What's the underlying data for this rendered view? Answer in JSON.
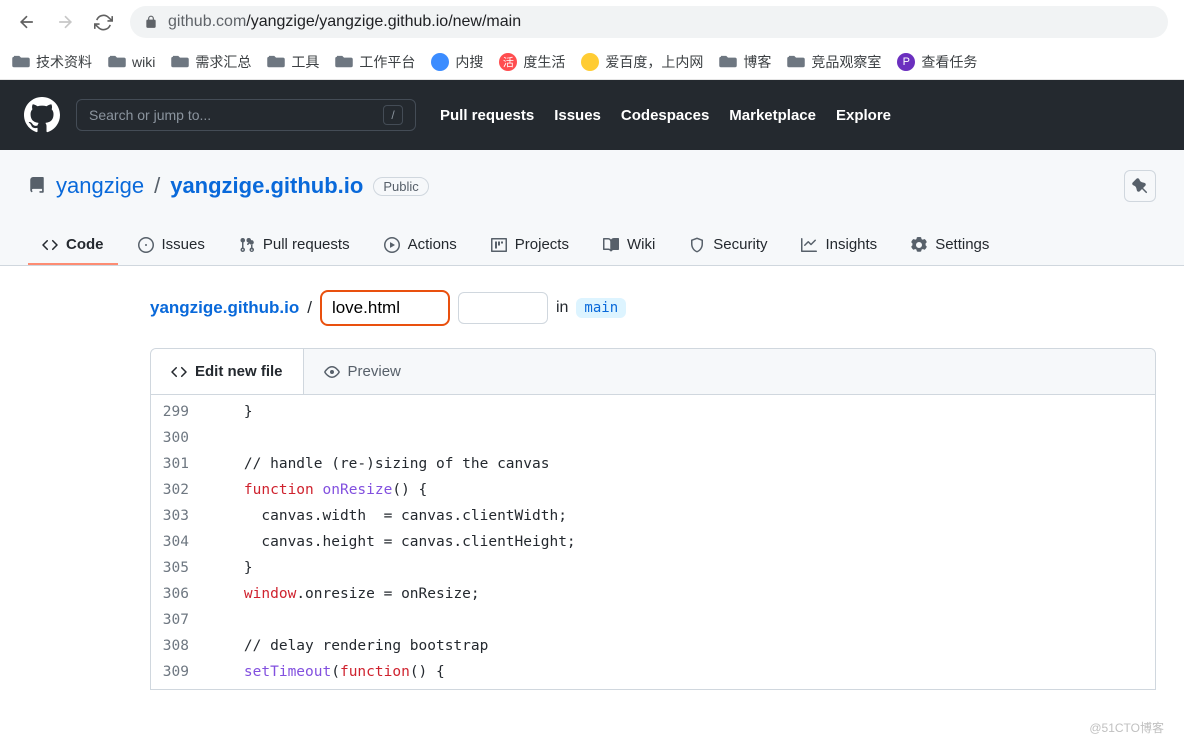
{
  "browser": {
    "url_host": "github.com",
    "url_path": "/yangzige/yangzige.github.io/new/main"
  },
  "bookmarks": [
    {
      "type": "folder",
      "label": "技术资料"
    },
    {
      "type": "folder",
      "label": "wiki"
    },
    {
      "type": "folder",
      "label": "需求汇总"
    },
    {
      "type": "folder",
      "label": "工具"
    },
    {
      "type": "folder",
      "label": "工作平台"
    },
    {
      "type": "icon",
      "label": "内搜",
      "bg": "#3b8cff"
    },
    {
      "type": "icon",
      "label": "度生活",
      "bg": "#ff4d4f",
      "glyph": "活"
    },
    {
      "type": "icon",
      "label": "爱百度，上内网",
      "bg": "#ffcc33"
    },
    {
      "type": "folder",
      "label": "博客"
    },
    {
      "type": "folder",
      "label": "竞品观察室"
    },
    {
      "type": "icon",
      "label": "查看任务",
      "bg": "#6b2fbf",
      "glyph": "P"
    }
  ],
  "github": {
    "search_placeholder": "Search or jump to...",
    "slash": "/",
    "nav": [
      "Pull requests",
      "Issues",
      "Codespaces",
      "Marketplace",
      "Explore"
    ]
  },
  "repo": {
    "owner": "yangzige",
    "name": "yangzige.github.io",
    "visibility": "Public",
    "tabs": [
      {
        "icon": "code",
        "label": "Code",
        "active": true
      },
      {
        "icon": "issue",
        "label": "Issues"
      },
      {
        "icon": "pr",
        "label": "Pull requests"
      },
      {
        "icon": "actions",
        "label": "Actions"
      },
      {
        "icon": "projects",
        "label": "Projects"
      },
      {
        "icon": "wiki",
        "label": "Wiki"
      },
      {
        "icon": "security",
        "label": "Security"
      },
      {
        "icon": "insights",
        "label": "Insights"
      },
      {
        "icon": "settings",
        "label": "Settings"
      }
    ]
  },
  "file": {
    "repo_path": "yangzige.github.io",
    "filename": "love.html",
    "in_label": "in",
    "branch": "main"
  },
  "editor": {
    "tab_edit": "Edit new file",
    "tab_preview": "Preview",
    "lines": [
      {
        "no": 299,
        "tokens": [
          [
            "    }",
            ""
          ]
        ]
      },
      {
        "no": 300,
        "tokens": [
          [
            "",
            ""
          ]
        ]
      },
      {
        "no": 301,
        "tokens": [
          [
            "    // handle (re-)sizing of the canvas",
            "comment"
          ]
        ]
      },
      {
        "no": 302,
        "tokens": [
          [
            "    ",
            ""
          ],
          [
            "function",
            "keyword"
          ],
          [
            " ",
            ""
          ],
          [
            "onResize",
            "func"
          ],
          [
            "() {",
            ""
          ]
        ]
      },
      {
        "no": 303,
        "tokens": [
          [
            "      canvas.width  = canvas.clientWidth;",
            ""
          ]
        ]
      },
      {
        "no": 304,
        "tokens": [
          [
            "      canvas.height = canvas.clientHeight;",
            ""
          ]
        ]
      },
      {
        "no": 305,
        "tokens": [
          [
            "    }",
            ""
          ]
        ]
      },
      {
        "no": 306,
        "tokens": [
          [
            "    ",
            ""
          ],
          [
            "window",
            "keyword"
          ],
          [
            ".onresize = onResize;",
            ""
          ]
        ]
      },
      {
        "no": 307,
        "tokens": [
          [
            "",
            ""
          ]
        ]
      },
      {
        "no": 308,
        "tokens": [
          [
            "    // delay rendering bootstrap",
            "comment"
          ]
        ]
      },
      {
        "no": 309,
        "tokens": [
          [
            "    ",
            ""
          ],
          [
            "setTimeout",
            "func"
          ],
          [
            "(",
            ""
          ],
          [
            "function",
            "keyword"
          ],
          [
            "() {",
            ""
          ]
        ]
      }
    ]
  },
  "watermark": "@51CTO博客"
}
